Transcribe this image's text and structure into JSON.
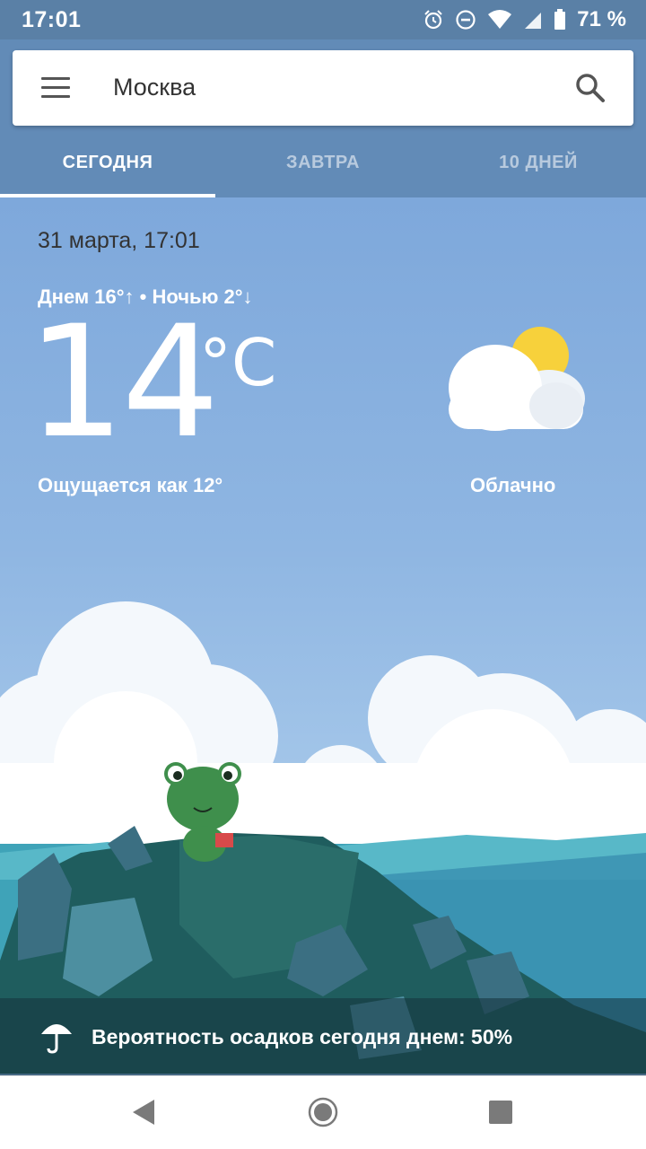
{
  "status_bar": {
    "time": "17:01",
    "battery": "71 %",
    "icons": [
      "alarm-icon",
      "do-not-disturb-icon",
      "wifi-icon",
      "signal-icon",
      "battery-icon"
    ]
  },
  "search": {
    "city": "Москва",
    "menu_icon": "menu-icon",
    "search_icon": "search-icon"
  },
  "tabs": [
    {
      "label": "СЕГОДНЯ",
      "active": true
    },
    {
      "label": "ЗАВТРА",
      "active": false
    },
    {
      "label": "10 ДНЕЙ",
      "active": false
    }
  ],
  "weather": {
    "datetime": "31 марта, 17:01",
    "day_night": "Днем 16°↑ • Ночью 2°↓",
    "temperature": "14",
    "unit": "°C",
    "feels_like": "Ощущается как 12°",
    "condition": "Облачно",
    "condition_icon": "partly-cloudy-icon"
  },
  "precipitation": {
    "text": "Вероятность осадков сегодня днем: 50%",
    "icon": "umbrella-icon"
  },
  "nav": {
    "back_icon": "back-icon",
    "home_icon": "home-icon",
    "recent_icon": "recent-apps-icon"
  },
  "colors": {
    "status_bar": "#5a80a6",
    "header": "#628bb7",
    "sky": "#84aedc",
    "sun": "#f7d13b"
  }
}
